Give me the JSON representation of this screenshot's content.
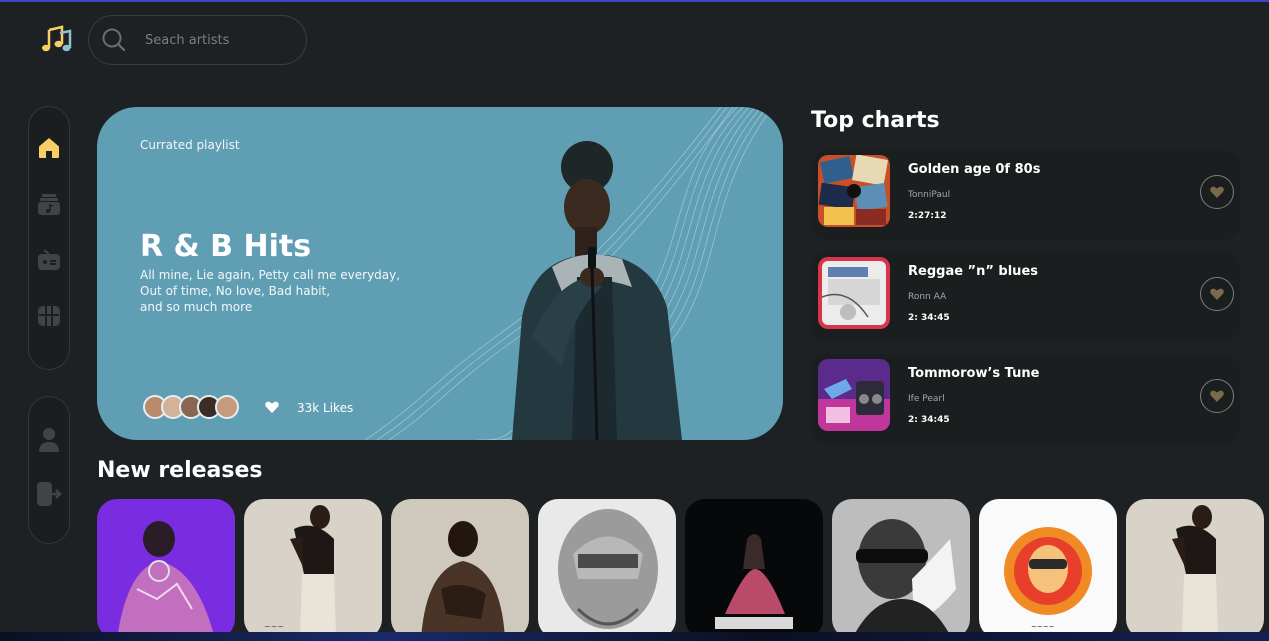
{
  "app": {
    "logo_icon": "music-notes-icon",
    "accent_color": "#facd66",
    "background_color": "#1d2123"
  },
  "search": {
    "placeholder": "Seach artists",
    "icon": "search-icon"
  },
  "sidebar": {
    "primary": [
      {
        "icon": "home-icon",
        "active": true
      },
      {
        "icon": "playlist-icon",
        "active": false
      },
      {
        "icon": "radio-icon",
        "active": false
      },
      {
        "icon": "videos-icon",
        "active": false
      }
    ],
    "secondary": [
      {
        "icon": "profile-icon"
      },
      {
        "icon": "logout-icon"
      }
    ]
  },
  "hero": {
    "eyebrow": "Currated playlist",
    "title": "R & B Hits",
    "description_lines": [
      "All mine, Lie again, Petty call me everyday,",
      "Out of time, No love, Bad habit,",
      "and so much more"
    ],
    "likes": "33k Likes",
    "background_color": "#609eb4"
  },
  "top_charts": {
    "title": "Top charts",
    "items": [
      {
        "title": "Golden age 0f 80s",
        "artist": "TonniPaul",
        "duration": "2:27:12"
      },
      {
        "title": "Reggae ”n” blues",
        "artist": "Ronn AA",
        "duration": "2: 34:45"
      },
      {
        "title": "Tommorow’s Tune",
        "artist": "Ife Pearl",
        "duration": "2: 34:45"
      }
    ]
  },
  "new_releases": {
    "title": "New releases",
    "count": 8
  }
}
